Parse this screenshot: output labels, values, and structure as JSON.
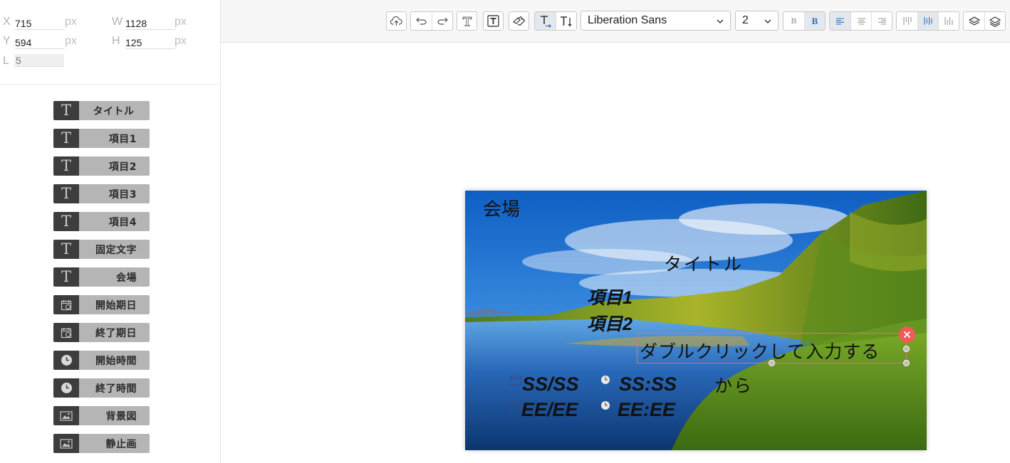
{
  "coords": {
    "x": {
      "label": "X",
      "value": "715",
      "unit": "px"
    },
    "w": {
      "label": "W",
      "value": "1128",
      "unit": "px"
    },
    "y": {
      "label": "Y",
      "value": "594",
      "unit": "px"
    },
    "h": {
      "label": "H",
      "value": "125",
      "unit": "px"
    },
    "l": {
      "label": "L",
      "value": "5"
    }
  },
  "tools": [
    {
      "label": "タイトル",
      "icon": "text-icon"
    },
    {
      "label": "項目1",
      "icon": "text-icon"
    },
    {
      "label": "項目2",
      "icon": "text-icon"
    },
    {
      "label": "項目3",
      "icon": "text-icon"
    },
    {
      "label": "項目4",
      "icon": "text-icon"
    },
    {
      "label": "固定文字",
      "icon": "text-icon"
    },
    {
      "label": "会場",
      "icon": "text-icon"
    },
    {
      "label": "開始期日",
      "icon": "calendar-icon"
    },
    {
      "label": "終了期日",
      "icon": "calendar-icon"
    },
    {
      "label": "開始時間",
      "icon": "clock-icon"
    },
    {
      "label": "終了時間",
      "icon": "clock-icon"
    },
    {
      "label": "背景図",
      "icon": "image-icon"
    },
    {
      "label": "静止画",
      "icon": "image-icon"
    }
  ],
  "toolbar": {
    "font_family": "Liberation Sans",
    "font_size": "2",
    "bold_off": "B",
    "bold_on": "B",
    "icons": [
      "upload-cloud-icon",
      "undo-icon",
      "redo-icon",
      "text-outline-icon",
      "text-fill-icon",
      "shape-icon",
      "text-direction-horizontal-icon",
      "text-direction-vertical-icon",
      "align-left-icon",
      "align-center-icon",
      "align-right-icon",
      "valign-top-icon",
      "valign-middle-icon",
      "valign-bottom-icon",
      "layer-up-icon",
      "layer-down-icon"
    ]
  },
  "card": {
    "venue": "会場",
    "title": "タイトル",
    "item1": "項目1",
    "item2": "項目2",
    "fixed_text": "ダブルクリックして入力する",
    "start_date": "SS/SS",
    "end_date": "EE/EE",
    "start_time": "SS:SS",
    "end_time": "EE:EE",
    "from": "から"
  },
  "colors": {
    "accent": "#2f6fb5",
    "delete": "#f25a5a",
    "selection": "#e57373",
    "tool_bg": "#b5b5b5",
    "tool_icon_bg": "#3d3d3d",
    "canvas_bg": "#b5c8d6"
  }
}
